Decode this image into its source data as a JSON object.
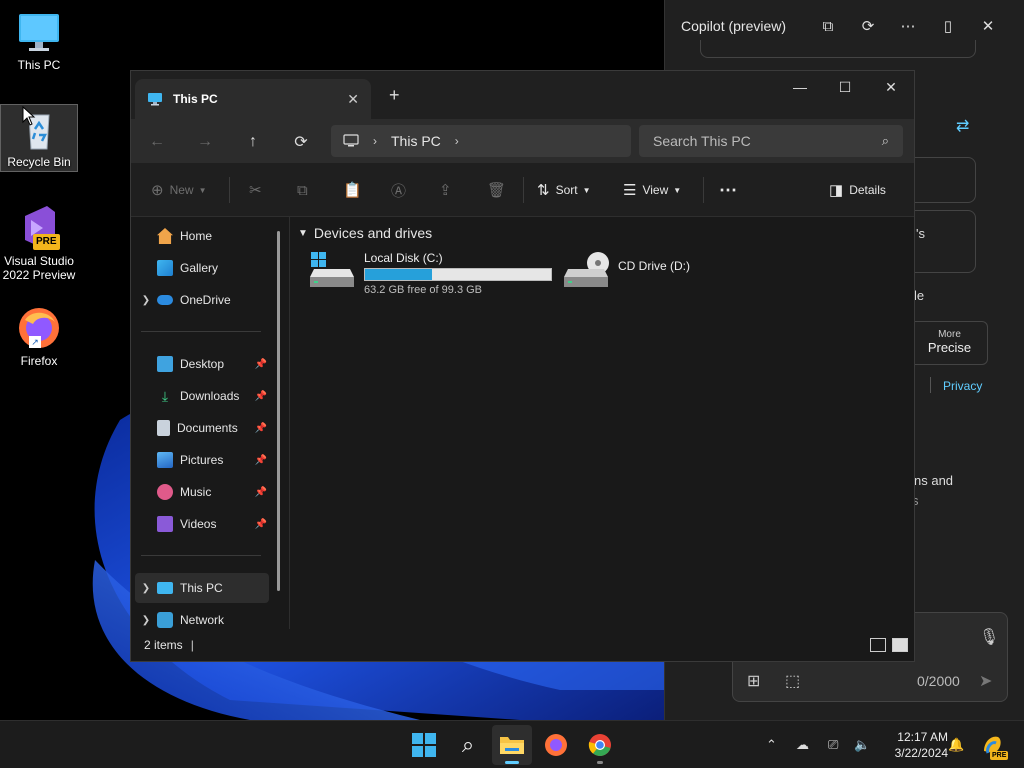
{
  "desktop": {
    "icons": [
      {
        "label": "This PC"
      },
      {
        "label": "Recycle Bin"
      },
      {
        "label": "Visual Studio 2022 Preview"
      },
      {
        "label": "Firefox"
      }
    ],
    "vs_badge": "PRE"
  },
  "copilot": {
    "title": "Copilot (preview)",
    "fragments": {
      "fragment1": "'s",
      "fragment2": "le",
      "more_label": "More",
      "precise_label": "Precise",
      "privacy": "Privacy",
      "fragment3": "ns and",
      "fragment4": "s"
    },
    "char_count": "0/2000"
  },
  "explorer": {
    "tab_title": "This PC",
    "address": {
      "location": "This PC"
    },
    "search_placeholder": "Search This PC",
    "commands": {
      "new": "New",
      "sort": "Sort",
      "view": "View",
      "details": "Details"
    },
    "nav": {
      "home": "Home",
      "gallery": "Gallery",
      "onedrive": "OneDrive",
      "desktop": "Desktop",
      "downloads": "Downloads",
      "documents": "Documents",
      "pictures": "Pictures",
      "music": "Music",
      "videos": "Videos",
      "thispc": "This PC",
      "network": "Network"
    },
    "group_title": "Devices and drives",
    "drives": [
      {
        "name": "Local Disk (C:)",
        "free": "63.2 GB free of 99.3 GB",
        "used_fraction": 0.36
      },
      {
        "name": "CD Drive (D:)"
      }
    ],
    "status": "2 items"
  },
  "taskbar": {
    "time": "12:17 AM",
    "date": "3/22/2024",
    "copilot_badge": "PRE"
  },
  "colors": {
    "accent": "#60cdff",
    "drive_bar": "#26a0da"
  }
}
